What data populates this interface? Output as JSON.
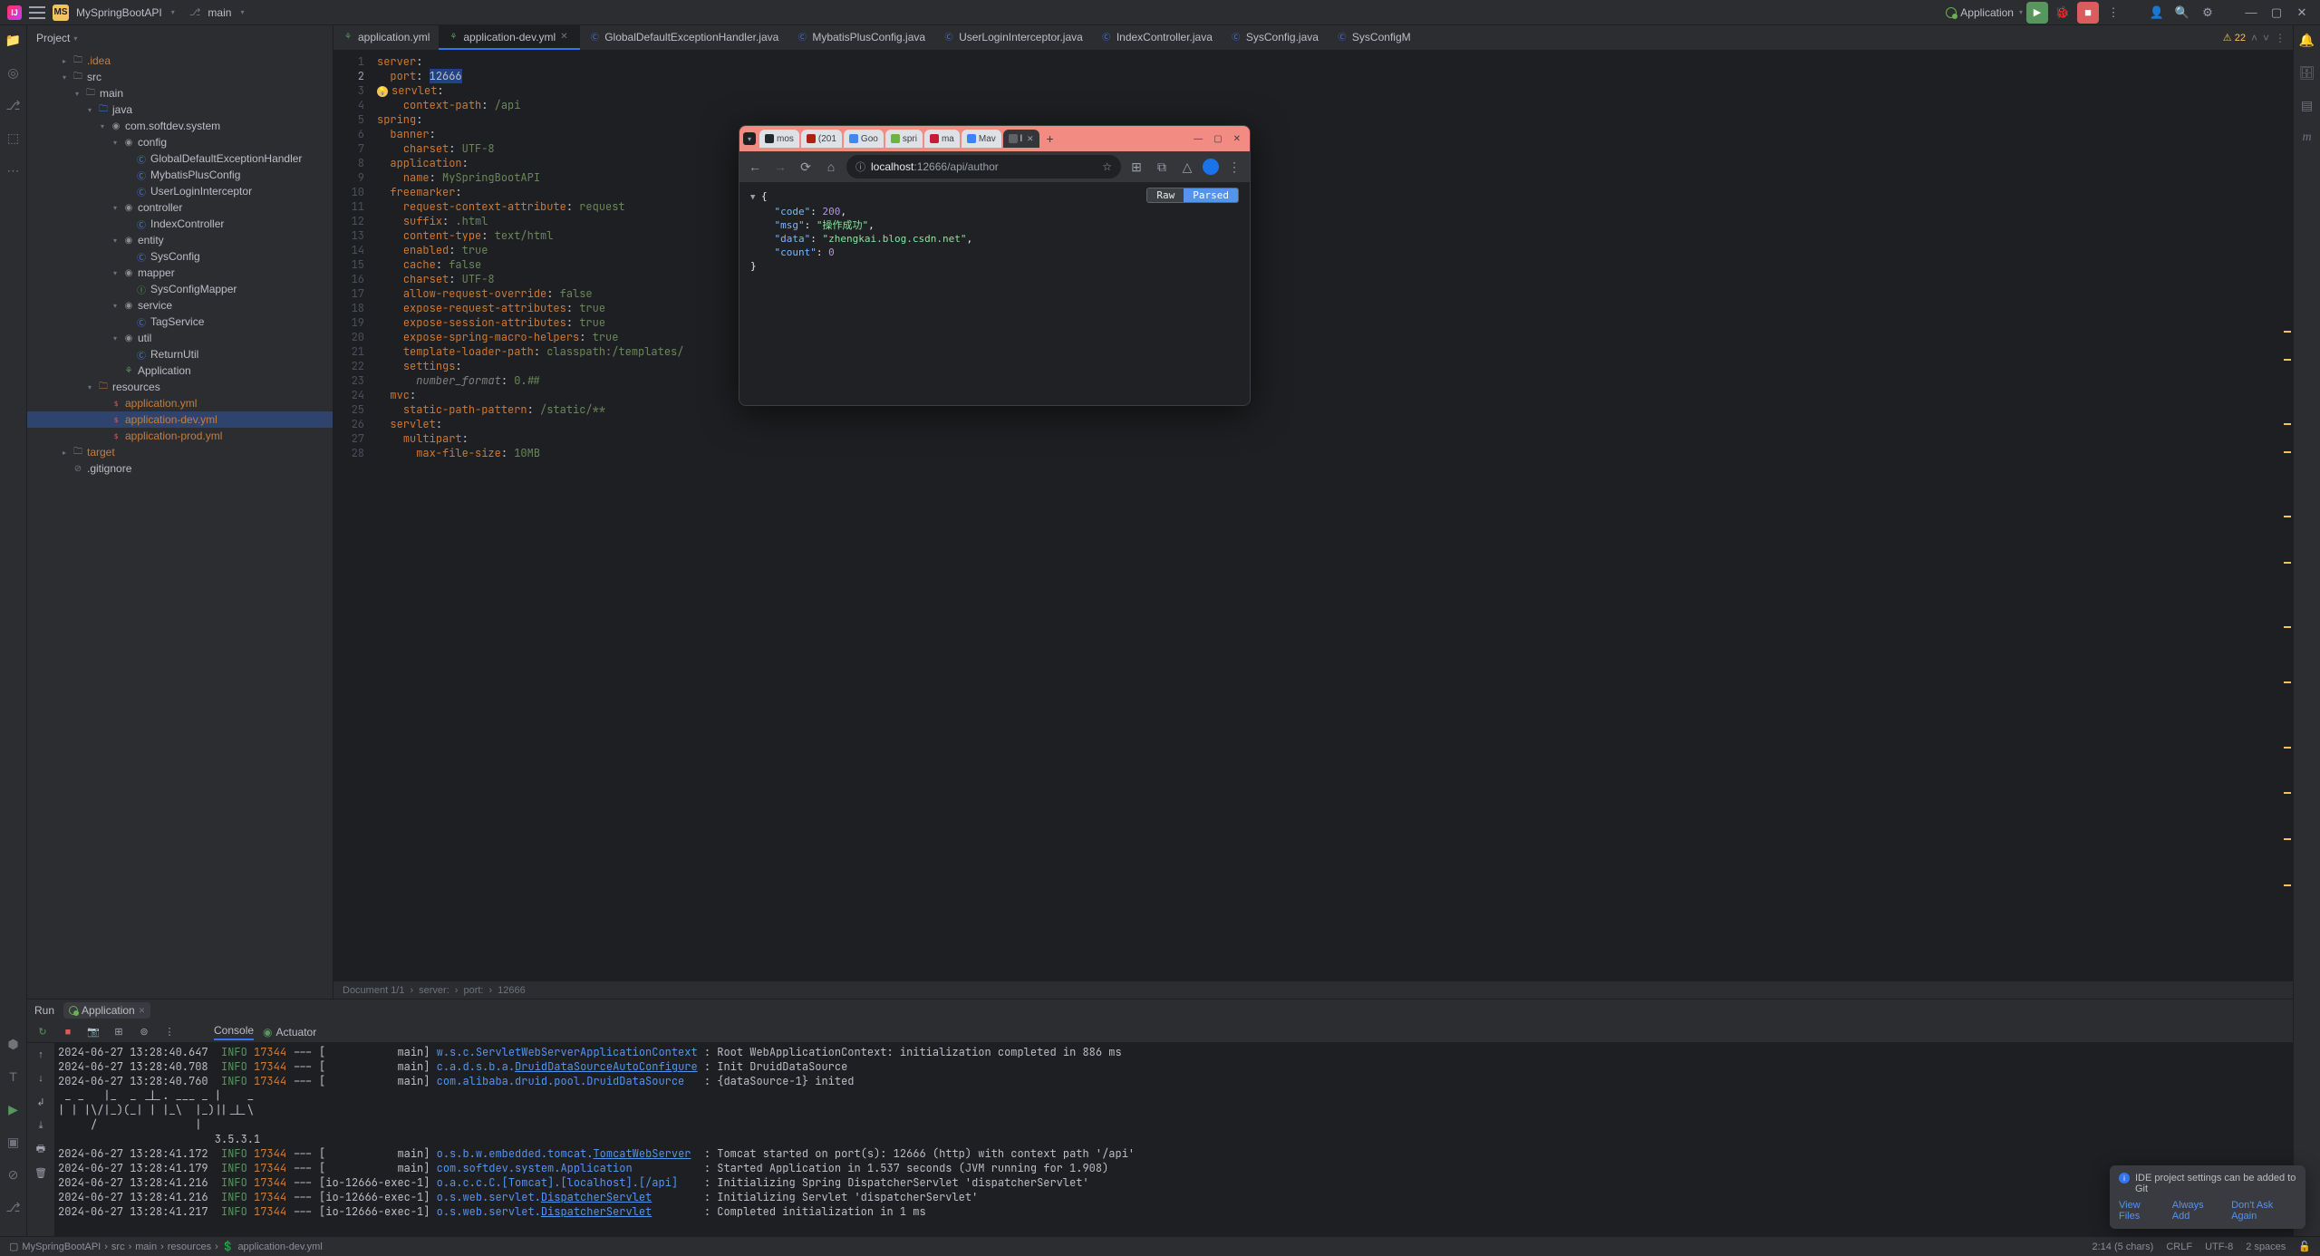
{
  "titlebar": {
    "project_badge": "MS",
    "project_name": "MySpringBootAPI",
    "branch": "main",
    "run_config": "Application"
  },
  "window_controls": [
    "min",
    "max",
    "close"
  ],
  "project_panel": {
    "title": "Project"
  },
  "tree": [
    {
      "depth": 2,
      "arrow": "right",
      "icon": "folder",
      "label": ".idea",
      "cls": "orange"
    },
    {
      "depth": 2,
      "arrow": "down",
      "icon": "folder",
      "label": "src"
    },
    {
      "depth": 3,
      "arrow": "down",
      "icon": "folder",
      "label": "main"
    },
    {
      "depth": 4,
      "arrow": "down",
      "icon": "java-folder",
      "label": "java"
    },
    {
      "depth": 5,
      "arrow": "down",
      "icon": "pkg",
      "label": "com.softdev.system"
    },
    {
      "depth": 6,
      "arrow": "down",
      "icon": "pkg",
      "label": "config"
    },
    {
      "depth": 7,
      "arrow": "",
      "icon": "class",
      "label": "GlobalDefaultExceptionHandler"
    },
    {
      "depth": 7,
      "arrow": "",
      "icon": "class",
      "label": "MybatisPlusConfig"
    },
    {
      "depth": 7,
      "arrow": "",
      "icon": "class",
      "label": "UserLoginInterceptor"
    },
    {
      "depth": 6,
      "arrow": "down",
      "icon": "pkg",
      "label": "controller"
    },
    {
      "depth": 7,
      "arrow": "",
      "icon": "class",
      "label": "IndexController"
    },
    {
      "depth": 6,
      "arrow": "down",
      "icon": "pkg",
      "label": "entity"
    },
    {
      "depth": 7,
      "arrow": "",
      "icon": "class",
      "label": "SysConfig"
    },
    {
      "depth": 6,
      "arrow": "down",
      "icon": "pkg",
      "label": "mapper"
    },
    {
      "depth": 7,
      "arrow": "",
      "icon": "interface",
      "label": "SysConfigMapper"
    },
    {
      "depth": 6,
      "arrow": "down",
      "icon": "pkg",
      "label": "service"
    },
    {
      "depth": 7,
      "arrow": "",
      "icon": "class",
      "label": "TagService"
    },
    {
      "depth": 6,
      "arrow": "down",
      "icon": "pkg",
      "label": "util"
    },
    {
      "depth": 7,
      "arrow": "",
      "icon": "class",
      "label": "ReturnUtil"
    },
    {
      "depth": 6,
      "arrow": "",
      "icon": "leaf",
      "label": "Application"
    },
    {
      "depth": 4,
      "arrow": "down",
      "icon": "res-folder",
      "label": "resources"
    },
    {
      "depth": 5,
      "arrow": "",
      "icon": "yml",
      "label": "application.yml",
      "cls": "orange"
    },
    {
      "depth": 5,
      "arrow": "",
      "icon": "yml",
      "label": "application-dev.yml",
      "cls": "orange",
      "selected": true
    },
    {
      "depth": 5,
      "arrow": "",
      "icon": "yml",
      "label": "application-prod.yml",
      "cls": "orange"
    },
    {
      "depth": 2,
      "arrow": "right",
      "icon": "folder",
      "label": "target",
      "cls": "orange"
    },
    {
      "depth": 2,
      "arrow": "",
      "icon": "ignore",
      "label": ".gitignore"
    }
  ],
  "editor_tabs": [
    {
      "icon": "leaf",
      "label": "application.yml",
      "active": false
    },
    {
      "icon": "leaf",
      "label": "application-dev.yml",
      "active": true,
      "close": true
    },
    {
      "icon": "class",
      "label": "GlobalDefaultExceptionHandler.java",
      "active": false
    },
    {
      "icon": "class",
      "label": "MybatisPlusConfig.java",
      "active": false
    },
    {
      "icon": "class",
      "label": "UserLoginInterceptor.java",
      "active": false
    },
    {
      "icon": "class",
      "label": "IndexController.java",
      "active": false
    },
    {
      "icon": "class",
      "label": "SysConfig.java",
      "active": false
    },
    {
      "icon": "class",
      "label": "SysConfigM",
      "active": false
    }
  ],
  "warnings_count": "22",
  "editor": {
    "lines": [
      {
        "n": 1,
        "html": "<span class='key'>server</span>:"
      },
      {
        "n": 2,
        "html": "  <span class='key'>port</span>: <span class='value sel'>12666</span>",
        "current": true
      },
      {
        "n": 3,
        "html": "<span class='gutter-mark'>💡</span><span class='key'>servlet</span>:"
      },
      {
        "n": 4,
        "html": "    <span class='key'>context-path</span>: <span class='value'>/api</span>"
      },
      {
        "n": 5,
        "html": "<span class='key'>spring</span>:"
      },
      {
        "n": 6,
        "html": "  <span class='key'>banner</span>:"
      },
      {
        "n": 7,
        "html": "    <span class='key'>charset</span>: <span class='value'>UTF-8</span>"
      },
      {
        "n": 8,
        "html": "  <span class='key'>application</span>:"
      },
      {
        "n": 9,
        "html": "    <span class='key'>name</span>: <span class='value'>MySpringBootAPI</span>"
      },
      {
        "n": 10,
        "html": "  <span class='key'>freemarker</span>:"
      },
      {
        "n": 11,
        "html": "    <span class='key'>request-context-attribute</span>: <span class='value'>request</span>"
      },
      {
        "n": 12,
        "html": "    <span class='key'>suffix</span>: <span class='value'>.html</span>"
      },
      {
        "n": 13,
        "html": "    <span class='key'>content-type</span>: <span class='value'>text/html</span>"
      },
      {
        "n": 14,
        "html": "    <span class='key'>enabled</span>: <span class='value'>true</span>"
      },
      {
        "n": 15,
        "html": "    <span class='key'>cache</span>: <span class='value'>false</span>"
      },
      {
        "n": 16,
        "html": "    <span class='key'>charset</span>: <span class='value'>UTF-8</span>"
      },
      {
        "n": 17,
        "html": "    <span class='key'>allow-request-override</span>: <span class='value'>false</span>"
      },
      {
        "n": 18,
        "html": "    <span class='key'>expose-request-attributes</span>: <span class='value'>true</span>"
      },
      {
        "n": 19,
        "html": "    <span class='key'>expose-session-attributes</span>: <span class='value'>true</span>"
      },
      {
        "n": 20,
        "html": "    <span class='key'>expose-spring-macro-helpers</span>: <span class='value'>true</span>"
      },
      {
        "n": 21,
        "html": "    <span class='key'>template-loader-path</span>: <span class='value'>classpath:/templates/</span>"
      },
      {
        "n": 22,
        "html": "    <span class='key'>settings</span>:"
      },
      {
        "n": 23,
        "html": "      <span class='italic'>number_format</span>: <span class='value'>0.##</span>"
      },
      {
        "n": 24,
        "html": "  <span class='key'>mvc</span>:"
      },
      {
        "n": 25,
        "html": "    <span class='key'>static-path-pattern</span>: <span class='value'>/static/**</span>"
      },
      {
        "n": 26,
        "html": "  <span class='key'>servlet</span>:"
      },
      {
        "n": 27,
        "html": "    <span class='key'>multipart</span>:"
      },
      {
        "n": 28,
        "html": "      <span class='key'>max-file-size</span>: <span class='value'>10MB</span>"
      }
    ]
  },
  "breadcrumb_info": {
    "doc": "Document 1/1",
    "path": [
      "server:",
      "port:",
      "12666"
    ]
  },
  "run": {
    "label": "Run",
    "tab": "Application",
    "toolbar_tabs": [
      "Console",
      "Actuator"
    ]
  },
  "console_lines": [
    "<span class='date'>2024-06-27 13:28:40.647</span>  <span class='info'>INFO</span> <span class='pid'>17344</span> --- [           main] <span class='cls'>w.s.c.ServletWebServerApplicationContext</span> : Root WebApplicationContext: initialization completed in 886 ms",
    "<span class='date'>2024-06-27 13:28:40.708</span>  <span class='info'>INFO</span> <span class='pid'>17344</span> --- [           main] <span class='cls'>c.a.d.s.b.a.<u>DruidDataSourceAutoConfigure</u></span> : Init DruidDataSource",
    "<span class='date'>2024-06-27 13:28:40.760</span>  <span class='info'>INFO</span> <span class='pid'>17344</span> --- [           main] <span class='cls'>com.alibaba.druid.pool.DruidDataSource</span>   : {dataSource-1} inited",
    " _ _   |_  _ _|_. ___ _ |    _ ",
    "| | |\\/|_)(_| | |_\\  |_)||_|_\\ ",
    "     /               |         ",
    "                        3.5.3.1 ",
    "<span class='date'>2024-06-27 13:28:41.172</span>  <span class='info'>INFO</span> <span class='pid'>17344</span> --- [           main] <span class='cls'>o.s.b.w.embedded.tomcat.<u>TomcatWebServer</u></span>  : Tomcat started on port(s): 12666 (http) with context path '/api'",
    "<span class='date'>2024-06-27 13:28:41.179</span>  <span class='info'>INFO</span> <span class='pid'>17344</span> --- [           main] <span class='cls'>com.softdev.system.Application</span>           : Started Application in 1.537 seconds (JVM running for 1.908)",
    "<span class='date'>2024-06-27 13:28:41.216</span>  <span class='info'>INFO</span> <span class='pid'>17344</span> --- [io-12666-exec-1] <span class='cls'>o.a.c.c.C.[Tomcat].[localhost].[/api]</span>    : Initializing Spring DispatcherServlet 'dispatcherServlet'",
    "<span class='date'>2024-06-27 13:28:41.216</span>  <span class='info'>INFO</span> <span class='pid'>17344</span> --- [io-12666-exec-1] <span class='cls'>o.s.web.servlet.<u>DispatcherServlet</u></span>        : Initializing Servlet 'dispatcherServlet'",
    "<span class='date'>2024-06-27 13:28:41.217</span>  <span class='info'>INFO</span> <span class='pid'>17344</span> --- [io-12666-exec-1] <span class='cls'>o.s.web.servlet.<u>DispatcherServlet</u></span>        : Completed initialization in 1 ms"
  ],
  "browser": {
    "tabs": [
      {
        "label": "mos",
        "color": "#24292e"
      },
      {
        "label": "(201",
        "color": "#ae2012"
      },
      {
        "label": "Goo",
        "color": "#4285f4"
      },
      {
        "label": "spri",
        "color": "#6db33f"
      },
      {
        "label": "ma",
        "color": "#c71a36"
      },
      {
        "label": "Mav",
        "color": "#3b82f6"
      }
    ],
    "active_tab": "l",
    "url_host": "localhost",
    "url_rest": ":12666/api/author",
    "json": {
      "code": 200,
      "msg": "操作成功",
      "data": "zhengkai.blog.csdn.net",
      "count": 0
    },
    "raw_label": "Raw",
    "parsed_label": "Parsed"
  },
  "notification": {
    "title": "IDE project settings can be added to Git",
    "actions": [
      "View Files",
      "Always Add",
      "Don't Ask Again"
    ]
  },
  "status_crumbs": [
    "MySpringBootAPI",
    "src",
    "main",
    "resources",
    "application-dev.yml"
  ],
  "status_right": {
    "pos": "2:14 (5 chars)",
    "sep": "CRLF",
    "enc": "UTF-8",
    "indent": "2 spaces"
  }
}
